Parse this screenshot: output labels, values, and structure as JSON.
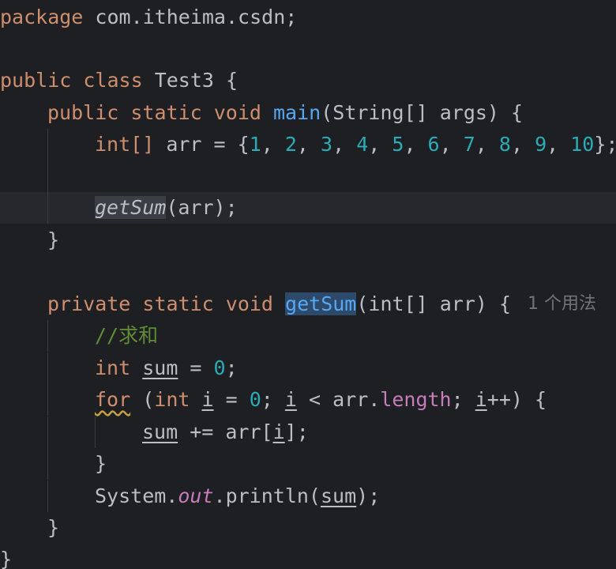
{
  "editor": {
    "package_kw": "package",
    "package_name": "com.itheima.csdn",
    "semi": ";",
    "class_kw": "public class",
    "class_name": "Test3",
    "open_brace": "{",
    "close_brace": "}",
    "main_mods": "public static void",
    "main_name": "main",
    "main_params": "(String[] args) {",
    "arr_type": "int[]",
    "arr_assign": "arr = {",
    "arr_values": [
      "1",
      "2",
      "3",
      "4",
      "5",
      "6",
      "7",
      "8",
      "9",
      "10"
    ],
    "arr_close": "};",
    "call_name": "getSum",
    "call_args": "(arr);",
    "method_mods": "private static void",
    "method_name": "getSum",
    "method_params": "(int[] arr) {",
    "usage_hint": "1 个用法",
    "comment": "//求和",
    "int_kw": "int",
    "sum_var": "sum",
    "assign_zero_eq": " = ",
    "zero": "0",
    "for_kw": "for",
    "for_open": " (",
    "i_var": "i",
    "lt": " < arr.",
    "length_field": "length",
    "incr": "++) {",
    "plus_eq": " += arr[",
    "bracket_close": "];",
    "system": "System.",
    "out_field": "out",
    "println": ".println(",
    "println_close": ");"
  }
}
